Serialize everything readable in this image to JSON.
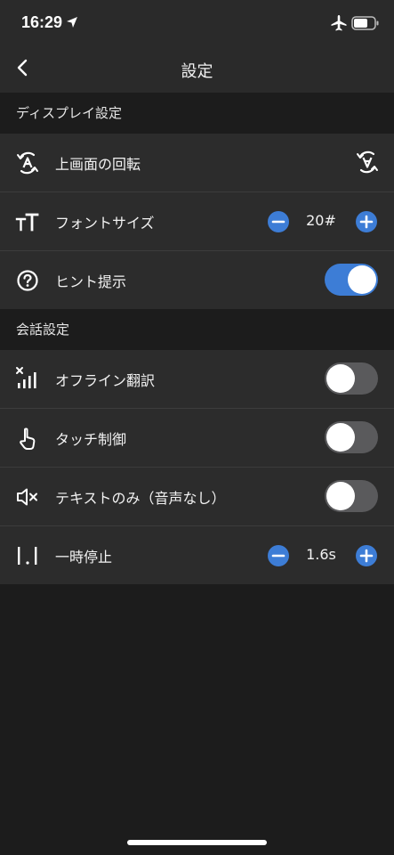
{
  "status_bar": {
    "time": "16:29",
    "location_icon": "location-arrow-icon",
    "airplane_icon": "airplane-icon",
    "battery_icon": "battery-icon",
    "battery_level_percent": 70
  },
  "nav": {
    "title": "設定",
    "back_icon": "chevron-left-icon"
  },
  "sections": {
    "display": {
      "header": "ディスプレイ設定",
      "rows": {
        "rotate": {
          "label": "上画面の回転",
          "icon": "rotate-a-icon",
          "action_icon": "rotate-a-icon"
        },
        "font_size": {
          "label": "フォントサイズ",
          "icon": "font-size-icon",
          "value": "20#"
        },
        "hints": {
          "label": "ヒント提示",
          "icon": "question-circle-icon",
          "toggle": true
        }
      }
    },
    "conversation": {
      "header": "会話設定",
      "rows": {
        "offline": {
          "label": "オフライン翻訳",
          "icon": "no-signal-icon",
          "toggle": false
        },
        "touch": {
          "label": "タッチ制御",
          "icon": "hand-tap-icon",
          "toggle": false
        },
        "text_only": {
          "label": "テキストのみ（音声なし）",
          "icon": "speaker-mute-icon",
          "toggle": false
        },
        "pause": {
          "label": "一時停止",
          "icon": "pause-interval-icon",
          "value": "1.6s"
        }
      }
    }
  },
  "colors": {
    "accent": "#3d7dd6",
    "background": "#1c1c1c",
    "row_background": "#2c2c2c",
    "toggle_off": "#5a5a5c"
  }
}
